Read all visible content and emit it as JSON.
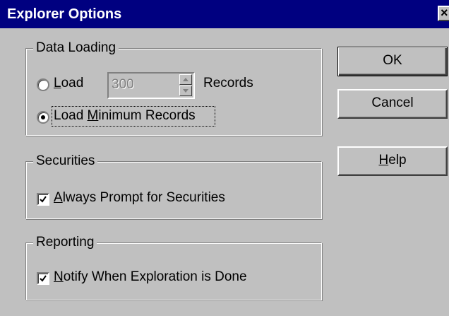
{
  "window": {
    "title": "Explorer Options",
    "close_glyph": "×"
  },
  "data_loading": {
    "legend": "Data Loading",
    "load_option": {
      "accel": "L",
      "rest": "oad",
      "selected": false
    },
    "records_spinner": {
      "value": "300",
      "enabled": false
    },
    "records_label": "Records",
    "load_minimum_option": {
      "prefix": "Load ",
      "accel": "M",
      "rest": "inimum Records",
      "selected": true
    }
  },
  "securities": {
    "legend": "Securities",
    "always_prompt": {
      "accel": "A",
      "rest": "lways Prompt for Securities",
      "checked": true
    }
  },
  "reporting": {
    "legend": "Reporting",
    "notify_done": {
      "accel": "N",
      "rest": "otify When Exploration is Done",
      "checked": true
    }
  },
  "buttons": {
    "ok": "OK",
    "cancel": "Cancel",
    "help_accel": "H",
    "help_rest": "elp"
  },
  "colors": {
    "titlebar": "#000080",
    "face": "#c0c0c0",
    "shadow": "#808080",
    "highlight": "#ffffff"
  }
}
